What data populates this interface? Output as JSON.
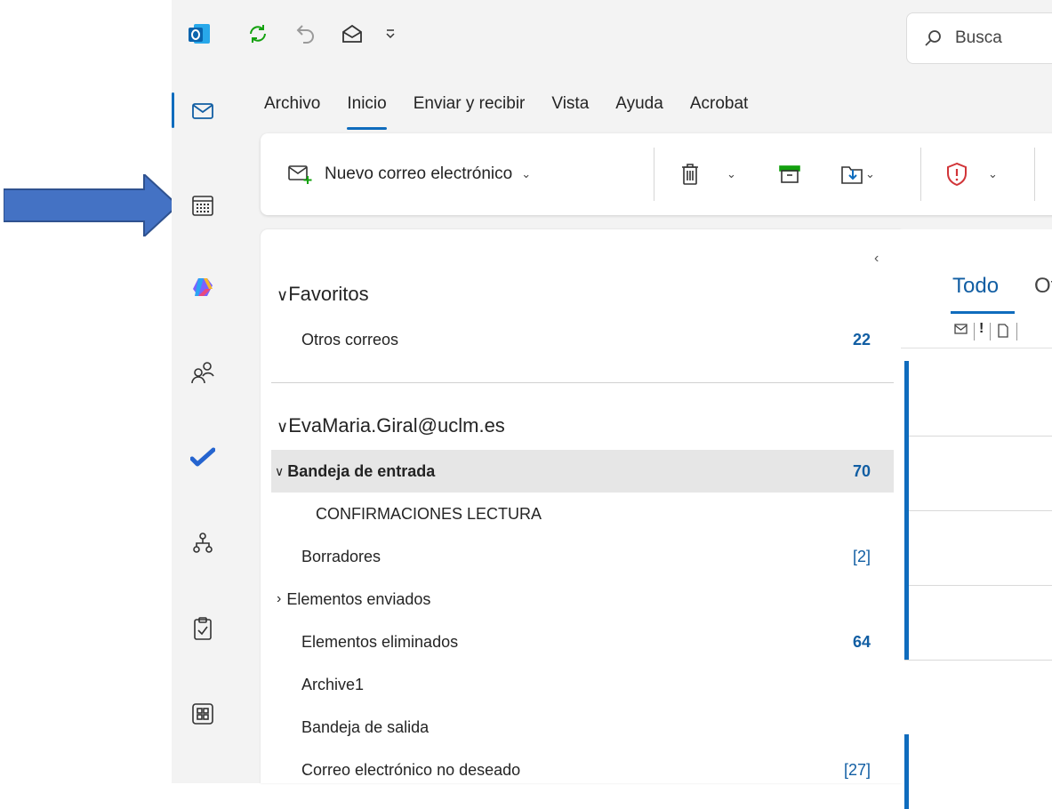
{
  "search": {
    "placeholder": "Busca"
  },
  "menu": [
    "Archivo",
    "Inicio",
    "Enviar y recibir",
    "Vista",
    "Ayuda",
    "Acrobat"
  ],
  "ribbon": {
    "new_mail_label": "Nuevo correo electrónico"
  },
  "tabs": {
    "all": "Todo",
    "other": "Ot"
  },
  "favorites": {
    "title": "Favoritos",
    "items": [
      {
        "name": "Otros correos",
        "count": "22"
      }
    ]
  },
  "account": {
    "title": "EvaMaria.Giral@uclm.es",
    "folders": [
      {
        "name": "Bandeja de entrada",
        "count": "70"
      },
      {
        "name": "CONFIRMACIONES LECTURA",
        "count": ""
      },
      {
        "name": "Borradores",
        "count": "[2]"
      },
      {
        "name": "Elementos enviados",
        "count": ""
      },
      {
        "name": "Elementos eliminados",
        "count": "64"
      },
      {
        "name": "Archive1",
        "count": ""
      },
      {
        "name": "Bandeja de salida",
        "count": ""
      },
      {
        "name": "Correo electrónico no deseado",
        "count": "[27]"
      }
    ]
  },
  "colors": {
    "accent": "#0f6cbd",
    "arrow": "#4472c4"
  }
}
